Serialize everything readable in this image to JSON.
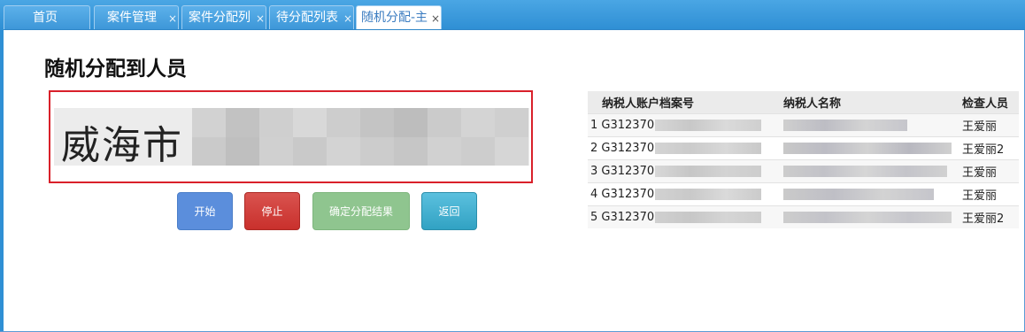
{
  "tabs": [
    {
      "label": "首页",
      "closable": false
    },
    {
      "label": "案件管理",
      "closable": true
    },
    {
      "label": "案件分配列",
      "closable": true
    },
    {
      "label": "待分配列表",
      "closable": true
    },
    {
      "label": "随机分配-主",
      "closable": true,
      "active": true
    }
  ],
  "close_glyph": "×",
  "page": {
    "title": "随机分配到人员",
    "display_text": "威海市"
  },
  "buttons": {
    "start": "开始",
    "stop": "停止",
    "confirm": "确定分配结果",
    "back": "返回"
  },
  "table": {
    "headers": [
      "纳税人账户档案号",
      "纳税人名称",
      "检查人员"
    ],
    "rows": [
      {
        "index": "1",
        "account": "G312370",
        "name": "",
        "inspector": "王爱丽"
      },
      {
        "index": "2",
        "account": "G312370",
        "name": "",
        "inspector": "王爱丽2"
      },
      {
        "index": "3",
        "account": "G312370",
        "name": "",
        "inspector": "王爱丽"
      },
      {
        "index": "4",
        "account": "G312370",
        "name": "",
        "inspector": "王爱丽"
      },
      {
        "index": "5",
        "account": "G312370",
        "name": "",
        "inspector": "王爱丽2"
      }
    ]
  },
  "colors": {
    "tabbar": "#2f8fd4",
    "highlight_border": "#d9202a",
    "start": "#5b8edc",
    "stop": "#d9534f",
    "confirm": "#8fc58f",
    "back": "#5bc0de"
  }
}
